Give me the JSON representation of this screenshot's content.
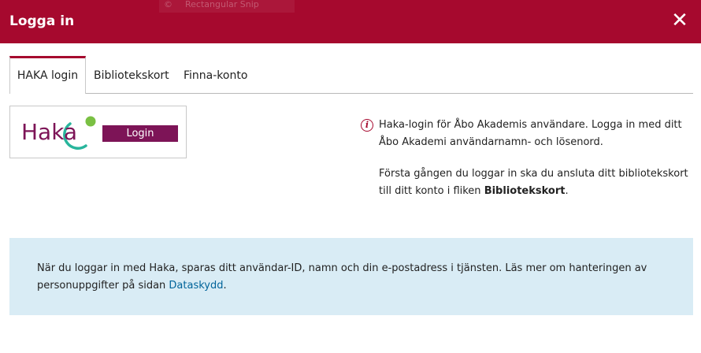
{
  "modal": {
    "title": "Logga in",
    "close_glyph": "✕"
  },
  "background": {
    "snip_icon_glyph": "©",
    "snip_label": "Rectangular Snip"
  },
  "tabs": [
    {
      "label": "HAKA login",
      "active": true
    },
    {
      "label": "Bibliotekskort",
      "active": false
    },
    {
      "label": "Finna-konto",
      "active": false
    }
  ],
  "haka": {
    "logo_text": "Haka",
    "button_label": "Login",
    "colors": {
      "logo_purple": "#7d1457",
      "logo_teal": "#28b59c",
      "logo_green": "#7ac043"
    }
  },
  "info": {
    "icon": "info-circle-icon",
    "paragraph1": "Haka-login för Åbo Akademis användare. Logga in med ditt Åbo Akademi användarnamn- och lösenord.",
    "paragraph2_prefix": "Första gången du loggar in ska du ansluta ditt bibliotekskort till ditt konto i fliken ",
    "paragraph2_bold": "Bibliotekskort",
    "paragraph2_suffix": "."
  },
  "notice": {
    "text": "När du loggar in med Haka, sparas ditt användar-ID, namn och din e-postadress i tjänsten. Läs mer om hanteringen av personuppgifter på sidan ",
    "link_label": "Dataskydd",
    "suffix": "."
  },
  "colors": {
    "header_bg": "#a6092e",
    "notice_bg": "#d9ecf5",
    "link": "#00649a"
  }
}
